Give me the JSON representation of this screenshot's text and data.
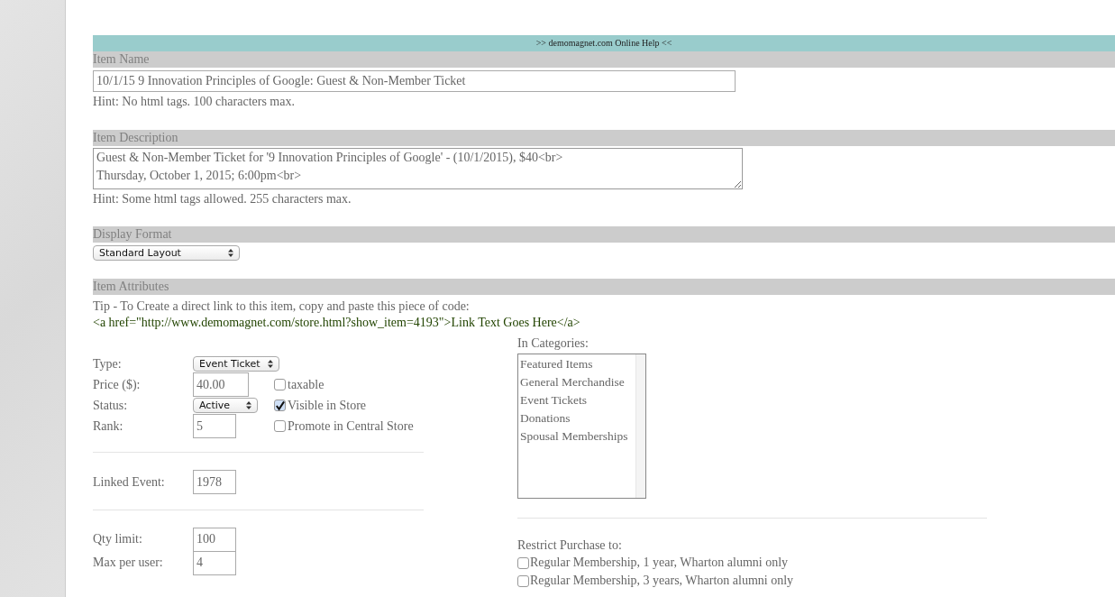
{
  "help_bar": {
    "text": ">> demomagnet.com Online Help <<"
  },
  "item_name": {
    "label": "Item Name",
    "value": "10/1/15 9 Innovation Principles of Google: Guest & Non-Member Ticket",
    "hint": "Hint: No html tags. 100 characters max."
  },
  "item_description": {
    "label": "Item Description",
    "value": "Guest & Non-Member Ticket for '9 Innovation Principles of Google' - (10/1/2015), $40<br>\nThursday, October 1, 2015; 6:00pm<br>",
    "hint": "Hint: Some html tags allowed. 255 characters max."
  },
  "display_format": {
    "label": "Display Format",
    "value": "Standard Layout"
  },
  "item_attributes": {
    "label": "Item Attributes",
    "tip": "Tip - To Create a direct link to this item, copy and paste this piece of code:",
    "code": "<a href=\"http://www.demomagnet.com/store.html?show_item=4193\">Link Text Goes Here</a>"
  },
  "attribute_rows": [
    {
      "label": "Type:",
      "kind": "select",
      "value": "Event Ticket"
    },
    {
      "label": "Price ($):",
      "kind": "input",
      "value": "40.00",
      "checkbox": {
        "label": "taxable",
        "checked": false
      }
    },
    {
      "label": "Status:",
      "kind": "select",
      "value": "Active",
      "checkbox": {
        "label": "Visible in Store",
        "checked": true
      }
    },
    {
      "label": "Rank:",
      "kind": "input",
      "value": "5",
      "checkbox": {
        "label": "Promote in Central Store",
        "checked": false
      }
    }
  ],
  "linked_event": {
    "label": "Linked Event:",
    "value": "1978"
  },
  "limits": [
    {
      "label": "Qty limit:",
      "value": "100"
    },
    {
      "label": "Max per user:",
      "value": "4"
    }
  ],
  "categories": {
    "label": "In Categories:",
    "items": [
      "Featured Items",
      "General Merchandise",
      "Event Tickets",
      "Donations",
      "Spousal Memberships"
    ]
  },
  "restrict": {
    "label": "Restrict Purchase to:",
    "options": [
      {
        "label": "Regular Membership, 1 year, Wharton alumni only",
        "checked": false
      },
      {
        "label": "Regular Membership, 3 years, Wharton alumni only",
        "checked": false
      }
    ]
  }
}
